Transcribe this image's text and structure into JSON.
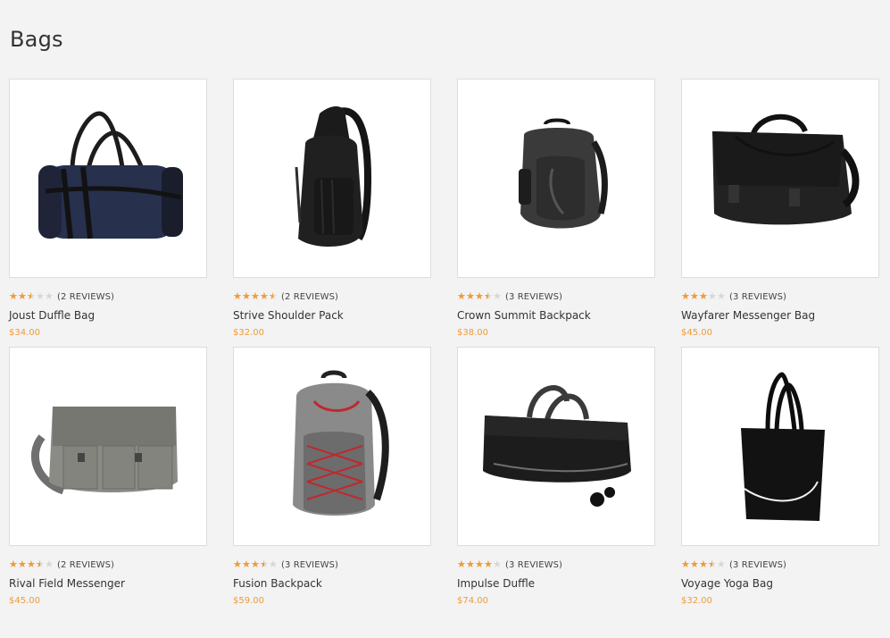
{
  "page": {
    "title": "Bags"
  },
  "colors": {
    "price": "#f09b37",
    "star_filled": "#f09b37",
    "star_empty": "#d7d7d7",
    "background": "#f3f3f3"
  },
  "products": [
    {
      "name": "Joust Duffle Bag",
      "reviews": "(2 REVIEWS)",
      "price": "$34.00",
      "rating": 2.5,
      "image": "navy duffle bag"
    },
    {
      "name": "Strive Shoulder Pack",
      "reviews": "(2 REVIEWS)",
      "price": "$32.00",
      "rating": 4.5,
      "image": "black sling backpack"
    },
    {
      "name": "Crown Summit Backpack",
      "reviews": "(3 REVIEWS)",
      "price": "$38.00",
      "rating": 3.5,
      "image": "charcoal backpack"
    },
    {
      "name": "Wayfarer Messenger Bag",
      "reviews": "(3 REVIEWS)",
      "price": "$45.00",
      "rating": 3,
      "image": "black messenger bag"
    },
    {
      "name": "Rival Field Messenger",
      "reviews": "(2 REVIEWS)",
      "price": "$45.00",
      "rating": 3.5,
      "image": "gray canvas messenger"
    },
    {
      "name": "Fusion Backpack",
      "reviews": "(3 REVIEWS)",
      "price": "$59.00",
      "rating": 3.5,
      "image": "gray backpack red cords"
    },
    {
      "name": "Impulse Duffle",
      "reviews": "(3 REVIEWS)",
      "price": "$74.00",
      "rating": 4,
      "image": "black rolling duffle"
    },
    {
      "name": "Voyage Yoga Bag",
      "reviews": "(3 REVIEWS)",
      "price": "$32.00",
      "rating": 3.5,
      "image": "black tote bag"
    }
  ]
}
